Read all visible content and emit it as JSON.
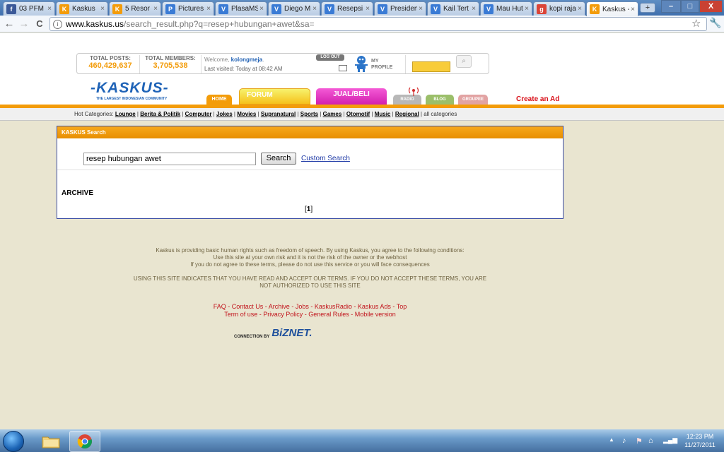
{
  "browser": {
    "tabs": [
      {
        "label": "03 PFM",
        "icon_color": "#3b5998",
        "icon_char": "f"
      },
      {
        "label": "Kaskus",
        "icon_color": "#f39c0a",
        "icon_char": "K"
      },
      {
        "label": "5 Resor (",
        "icon_color": "#f39c0a",
        "icon_char": "K"
      },
      {
        "label": "Pictures",
        "icon_color": "#3a7bd5",
        "icon_char": "P"
      },
      {
        "label": "PlasaMS",
        "icon_color": "#3a7bd5",
        "icon_char": "V"
      },
      {
        "label": "Diego M",
        "icon_color": "#3a7bd5",
        "icon_char": "V"
      },
      {
        "label": "Resepsi",
        "icon_color": "#3a7bd5",
        "icon_char": "V"
      },
      {
        "label": "Presiden",
        "icon_color": "#3a7bd5",
        "icon_char": "V"
      },
      {
        "label": "Kail Tert",
        "icon_color": "#3a7bd5",
        "icon_char": "V"
      },
      {
        "label": "Mau Hut",
        "icon_color": "#3a7bd5",
        "icon_char": "V"
      },
      {
        "label": "kopi raja",
        "icon_color": "#db4437",
        "icon_char": "g"
      },
      {
        "label": "Kaskus -",
        "icon_color": "#f39c0a",
        "icon_char": "K",
        "active": true
      }
    ],
    "tab_close": "×",
    "newtab": "+",
    "window": {
      "minimize": "–",
      "maximize": "□",
      "close": "X"
    },
    "nav": {
      "back": "←",
      "forward": "→",
      "reload": "C"
    },
    "url_host": "www.kaskus.us",
    "url_path": "/search_result.php?q=resep+hubungan+awet&sa=",
    "star": "☆",
    "wrench": "🔧"
  },
  "header": {
    "total_posts_label": "TOTAL POSTS:",
    "total_posts": "460,429,637",
    "total_members_label": "TOTAL MEMBERS:",
    "total_members": "3,705,538",
    "welcome_prefix": "Welcome,",
    "username": "kolongmeja",
    "last_visited": "Last visited: Today at 08:42 AM",
    "logout": "LOG OUT",
    "my_profile": "MY PROFILE"
  },
  "logo": {
    "word": "-KASKUS-",
    "tagline": "THE LARGEST INDONESIAN COMMUNITY"
  },
  "nav_tabs": [
    {
      "label": "HOME"
    },
    {
      "label": "FORUM"
    },
    {
      "label": "JUAL/BELI"
    },
    {
      "label": "RADIO"
    },
    {
      "label": "BLOG"
    },
    {
      "label": "GROUPEE"
    }
  ],
  "create_ad": "Create an Ad",
  "hot_categories": {
    "label": "Hot Categories:",
    "items": [
      "Lounge",
      "Berita & Politik",
      "Computer",
      "Jokes",
      "Movies",
      "Supranatural",
      "Sports",
      "Games",
      "Otomotif",
      "Music",
      "Regional"
    ],
    "all": "all categories",
    "separator": " | "
  },
  "search_panel": {
    "title": "KASKUS Search",
    "query": "resep hubungan awet",
    "button": "Search",
    "custom_search": "Custom Search",
    "archive": "ARCHIVE",
    "page_open": "[",
    "page_current": "1",
    "page_close": "]"
  },
  "footer": {
    "line1": "Kaskus is providing basic human rights such as freedom of speech. By using Kaskus, you agree to the following conditions:",
    "line2": "Use this site at your own risk and it is not the risk of the owner or the webhost",
    "line3": "If you do not agree to these terms, please do not use this service or you will face consequences",
    "line4": "USING THIS SITE INDICATES THAT YOU HAVE READ AND ACCEPT OUR TERMS. IF YOU DO NOT ACCEPT THESE TERMS, YOU ARE",
    "line5": "NOT AUTHORIZED TO USE THIS SITE",
    "links1": [
      "FAQ",
      "Contact Us",
      "Archive",
      "Jobs",
      "KaskusRadio",
      "Kaskus Ads",
      "Top"
    ],
    "links2": [
      "Term of use",
      "Privacy Policy",
      "General Rules",
      "Mobile version"
    ],
    "link_sep": " - ",
    "connection_by": "CONNECTION BY",
    "biznet": "BiZNET."
  },
  "taskbar": {
    "time": "12:23 PM",
    "date": "11/27/2011",
    "tray_arrow": "▲"
  }
}
